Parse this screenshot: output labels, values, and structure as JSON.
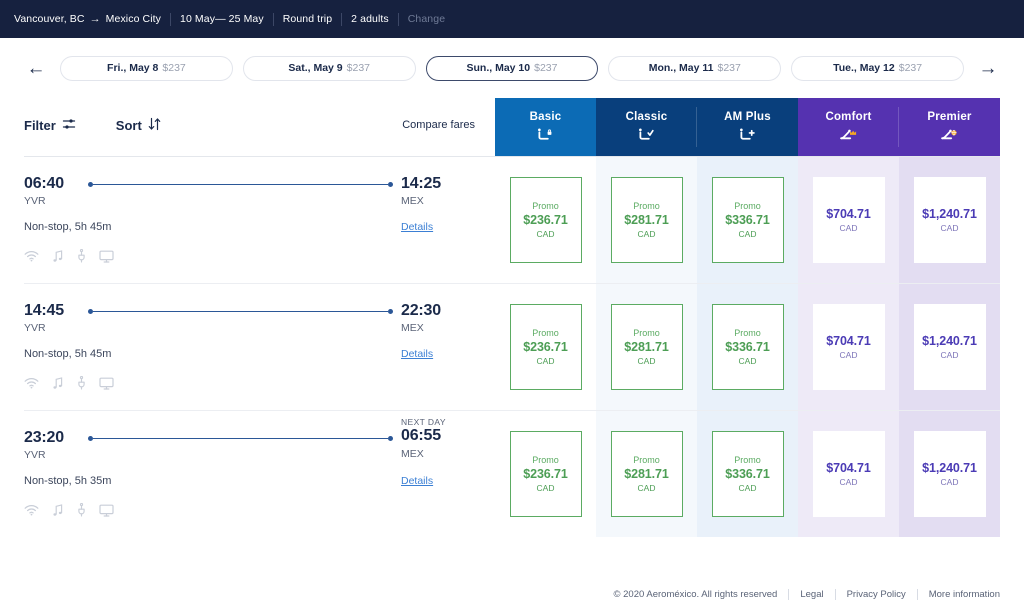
{
  "navbar": {
    "origin": "Vancouver, BC",
    "arrow_icon": "arrow-right-icon",
    "destination": "Mexico City",
    "dates": "10 May— 25 May",
    "trip_type": "Round trip",
    "passengers": "2 adults",
    "change_label": "Change",
    "background": "#16213f"
  },
  "datebar": {
    "prev_icon": "arrow-left-icon",
    "next_icon": "arrow-right-icon",
    "pills": [
      {
        "label": "Fri., May 8",
        "price": "$237",
        "selected": false
      },
      {
        "label": "Sat., May 9",
        "price": "$237",
        "selected": false
      },
      {
        "label": "Sun., May 10",
        "price": "$237",
        "selected": true
      },
      {
        "label": "Mon., May 11",
        "price": "$237",
        "selected": false
      },
      {
        "label": "Tue., May 12",
        "price": "$237",
        "selected": false
      }
    ]
  },
  "toolbar": {
    "filter_label": "Filter",
    "filter_icon": "sliders-icon",
    "sort_label": "Sort",
    "sort_icon": "sort-arrows-icon",
    "compare_label": "Compare fares"
  },
  "fare_columns": [
    {
      "label": "Basic",
      "icon": "seat-lock-icon",
      "header_bg": "#0c6bb5",
      "cell_bg": "#ffffff"
    },
    {
      "label": "Classic",
      "icon": "seat-check-icon",
      "header_bg": "#093f7c",
      "cell_bg": "#f4f8fc"
    },
    {
      "label": "AM Plus",
      "icon": "seat-plus-icon",
      "header_bg": "#093f7c",
      "cell_bg": "#e9f1fa"
    },
    {
      "label": "Comfort",
      "icon": "seat-crown-icon",
      "header_bg": "#5532b0",
      "cell_bg": "#eeeaf7"
    },
    {
      "label": "Premier",
      "icon": "seat-globe-icon",
      "header_bg": "#5532b0",
      "cell_bg": "#e3ddf2"
    }
  ],
  "flights": [
    {
      "depart_time": "06:40",
      "depart_code": "YVR",
      "arrive_time": "14:25",
      "arrive_code": "MEX",
      "next_day_label": "",
      "duration": "Non-stop, 5h 45m",
      "details_label": "Details",
      "amenities": [
        "wifi-icon",
        "music-icon",
        "power-outlet-icon",
        "screen-icon"
      ],
      "fares": [
        {
          "tag": "Promo",
          "price": "$236.71",
          "currency": "CAD",
          "style": "promo"
        },
        {
          "tag": "Promo",
          "price": "$281.71",
          "currency": "CAD",
          "style": "promo"
        },
        {
          "tag": "Promo",
          "price": "$336.71",
          "currency": "CAD",
          "style": "promo"
        },
        {
          "tag": "",
          "price": "$704.71",
          "currency": "CAD",
          "style": "plain"
        },
        {
          "tag": "",
          "price": "$1,240.71",
          "currency": "CAD",
          "style": "plain"
        }
      ]
    },
    {
      "depart_time": "14:45",
      "depart_code": "YVR",
      "arrive_time": "22:30",
      "arrive_code": "MEX",
      "next_day_label": "",
      "duration": "Non-stop, 5h 45m",
      "details_label": "Details",
      "amenities": [
        "wifi-icon",
        "music-icon",
        "power-outlet-icon",
        "screen-icon"
      ],
      "fares": [
        {
          "tag": "Promo",
          "price": "$236.71",
          "currency": "CAD",
          "style": "promo"
        },
        {
          "tag": "Promo",
          "price": "$281.71",
          "currency": "CAD",
          "style": "promo"
        },
        {
          "tag": "Promo",
          "price": "$336.71",
          "currency": "CAD",
          "style": "promo"
        },
        {
          "tag": "",
          "price": "$704.71",
          "currency": "CAD",
          "style": "plain"
        },
        {
          "tag": "",
          "price": "$1,240.71",
          "currency": "CAD",
          "style": "plain"
        }
      ]
    },
    {
      "depart_time": "23:20",
      "depart_code": "YVR",
      "arrive_time": "06:55",
      "arrive_code": "MEX",
      "next_day_label": "NEXT DAY",
      "duration": "Non-stop, 5h 35m",
      "details_label": "Details",
      "amenities": [
        "wifi-icon",
        "music-icon",
        "power-outlet-icon",
        "screen-icon"
      ],
      "fares": [
        {
          "tag": "Promo",
          "price": "$236.71",
          "currency": "CAD",
          "style": "promo"
        },
        {
          "tag": "Promo",
          "price": "$281.71",
          "currency": "CAD",
          "style": "promo"
        },
        {
          "tag": "Promo",
          "price": "$336.71",
          "currency": "CAD",
          "style": "promo"
        },
        {
          "tag": "",
          "price": "$704.71",
          "currency": "CAD",
          "style": "plain"
        },
        {
          "tag": "",
          "price": "$1,240.71",
          "currency": "CAD",
          "style": "plain"
        }
      ]
    }
  ],
  "footer": {
    "copyright": "© 2020 Aeroméxico. All rights reserved",
    "links": [
      "Legal",
      "Privacy Policy",
      "More information"
    ]
  },
  "colors": {
    "navy": "#16213f",
    "accent_blue": "#0c6bb5",
    "purple": "#5532b0",
    "promo_green": "#4d9e55",
    "link_blue": "#3b7fd4"
  }
}
